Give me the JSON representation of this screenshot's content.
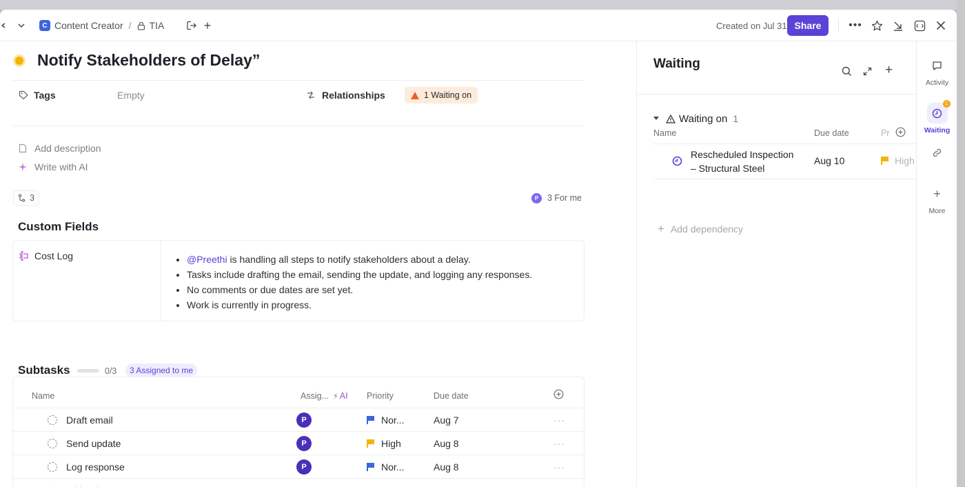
{
  "breadcrumb": {
    "workspace_initial": "C",
    "workspace": "Content Creator",
    "separator": "/",
    "list": "TIA"
  },
  "header": {
    "created": "Created on Jul 31",
    "share": "Share"
  },
  "task": {
    "title": "Notify Stakeholders of Delay”",
    "tags_label": "Tags",
    "tags_value": "Empty",
    "relationships_label": "Relationships",
    "waiting_badge": "1 Waiting on",
    "add_description": "Add description",
    "write_ai": "Write with AI",
    "checklist_count": "3",
    "for_me": "3 For me",
    "for_me_avatar": "P"
  },
  "custom_fields": {
    "title": "Custom Fields",
    "field_name": "Cost Log",
    "mention": "@Preethi",
    "bullet1_rest": " is handling all steps to notify stakeholders about a delay.",
    "bullet2": "Tasks include drafting the email, sending the update, and logging any responses.",
    "bullet3": "No comments or due dates are set yet.",
    "bullet4": "Work is currently in progress."
  },
  "subtasks": {
    "title": "Subtasks",
    "progress": "0/3",
    "progress_fraction": 0,
    "assigned": "3 Assigned to me",
    "headers": {
      "name": "Name",
      "assignee": "Assig...",
      "ai": "AI",
      "priority": "Priority",
      "due": "Due date"
    },
    "rows": [
      {
        "name": "Draft email",
        "avatar": "P",
        "priority": "Nor...",
        "priority_color": "#3d63dd",
        "due": "Aug 7"
      },
      {
        "name": "Send update",
        "avatar": "P",
        "priority": "High",
        "priority_color": "#f5b400",
        "due": "Aug 8"
      },
      {
        "name": "Log response",
        "avatar": "P",
        "priority": "Nor...",
        "priority_color": "#3d63dd",
        "due": "Aug 8"
      }
    ],
    "add_task": "Add Task"
  },
  "waiting_panel": {
    "title": "Waiting",
    "group": "Waiting on",
    "group_count": "1",
    "headers": {
      "name": "Name",
      "due": "Due date",
      "priority": "Pr"
    },
    "item": {
      "name_line1": "Rescheduled Inspection",
      "name_line2": "– Structural Steel",
      "due": "Aug 10",
      "priority": "High"
    },
    "add_dependency": "Add dependency"
  },
  "sidebar": {
    "activity": "Activity",
    "waiting": "Waiting",
    "waiting_badge": "1",
    "more": "More"
  },
  "colors": {
    "accent": "#5a43d6",
    "warning": "#e8612c",
    "title_dot": "#f5b400"
  }
}
